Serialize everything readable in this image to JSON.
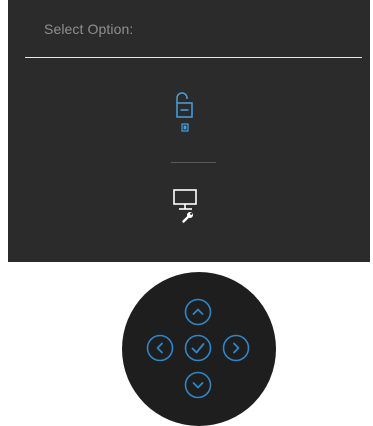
{
  "menu": {
    "prompt": "Select Option:",
    "options": [
      {
        "icon": "unlock-icon"
      },
      {
        "icon": "display-diagnostics-icon"
      }
    ]
  },
  "joystick": {
    "buttons": [
      {
        "icon": "chevron-up-icon"
      },
      {
        "icon": "chevron-left-icon"
      },
      {
        "icon": "checkmark-icon"
      },
      {
        "icon": "chevron-right-icon"
      },
      {
        "icon": "chevron-down-icon"
      }
    ]
  },
  "colors": {
    "panel_background": "#2b2b2b",
    "prompt_text": "#8f8f8f",
    "divider": "#e8e8e8",
    "option_icon": "#4a9edc",
    "diagnostics_icon": "#ffffff",
    "joystick_background": "#1e1e1e",
    "joystick_accent": "#2f86c7"
  }
}
